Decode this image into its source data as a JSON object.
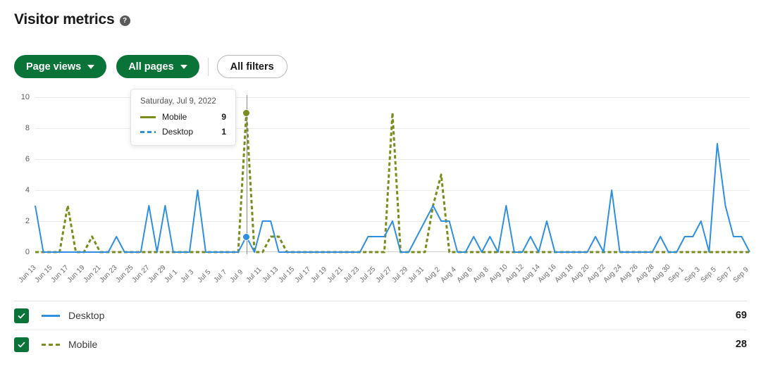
{
  "header": {
    "title": "Visitor metrics",
    "help_icon": "help-circle-icon",
    "help_glyph": "?"
  },
  "toolbar": {
    "metric_button": "Page views",
    "pages_button": "All pages",
    "filters_button": "All filters"
  },
  "tooltip": {
    "date": "Saturday, Jul 9, 2022",
    "rows": [
      {
        "name": "Mobile",
        "value": "9",
        "style": "solid",
        "color": "#7a8c1c"
      },
      {
        "name": "Desktop",
        "value": "1",
        "style": "dash",
        "color": "#2f8fe0"
      }
    ]
  },
  "legend": {
    "rows": [
      {
        "label": "Desktop",
        "value": "69",
        "style": "solid",
        "color": "#2f8fe0",
        "checked": true
      },
      {
        "label": "Mobile",
        "value": "28",
        "style": "dash",
        "color": "#7a8c1c",
        "checked": true
      }
    ]
  },
  "colors": {
    "brand_green": "#0a7338",
    "desktop": "#2f8fe0",
    "mobile": "#7a8c1c",
    "grid": "#ebebeb"
  },
  "chart_data": {
    "type": "line",
    "title": "Visitor metrics",
    "xlabel": "",
    "ylabel": "",
    "ylim": [
      0,
      10
    ],
    "yticks": [
      0,
      2,
      4,
      6,
      8,
      10
    ],
    "grid": true,
    "legend_position": "bottom",
    "tick_step_days": 2,
    "x": [
      "Jun 13",
      "Jun 14",
      "Jun 15",
      "Jun 16",
      "Jun 17",
      "Jun 18",
      "Jun 19",
      "Jun 20",
      "Jun 21",
      "Jun 22",
      "Jun 23",
      "Jun 24",
      "Jun 25",
      "Jun 26",
      "Jun 27",
      "Jun 28",
      "Jun 29",
      "Jun 30",
      "Jul 1",
      "Jul 2",
      "Jul 3",
      "Jul 4",
      "Jul 5",
      "Jul 6",
      "Jul 7",
      "Jul 8",
      "Jul 9",
      "Jul 10",
      "Jul 11",
      "Jul 12",
      "Jul 13",
      "Jul 14",
      "Jul 15",
      "Jul 16",
      "Jul 17",
      "Jul 18",
      "Jul 19",
      "Jul 20",
      "Jul 21",
      "Jul 22",
      "Jul 23",
      "Jul 24",
      "Jul 25",
      "Jul 26",
      "Jul 27",
      "Jul 28",
      "Jul 29",
      "Jul 30",
      "Jul 31",
      "Aug 1",
      "Aug 2",
      "Aug 3",
      "Aug 4",
      "Aug 5",
      "Aug 6",
      "Aug 7",
      "Aug 8",
      "Aug 9",
      "Aug 10",
      "Aug 11",
      "Aug 12",
      "Aug 13",
      "Aug 14",
      "Aug 15",
      "Aug 16",
      "Aug 17",
      "Aug 18",
      "Aug 19",
      "Aug 20",
      "Aug 21",
      "Aug 22",
      "Aug 23",
      "Aug 24",
      "Aug 25",
      "Aug 26",
      "Aug 27",
      "Aug 28",
      "Aug 29",
      "Aug 30",
      "Aug 31",
      "Sep 1",
      "Sep 2",
      "Sep 3",
      "Sep 4",
      "Sep 5",
      "Sep 6",
      "Sep 7",
      "Sep 8",
      "Sep 9"
    ],
    "xticks": [
      "Jun 13",
      "Jun 15",
      "Jun 17",
      "Jun 19",
      "Jun 21",
      "Jun 23",
      "Jun 25",
      "Jun 27",
      "Jun 29",
      "Jul 1",
      "Jul 3",
      "Jul 5",
      "Jul 7",
      "Jul 9",
      "Jul 11",
      "Jul 13",
      "Jul 15",
      "Jul 17",
      "Jul 19",
      "Jul 21",
      "Jul 23",
      "Jul 25",
      "Jul 27",
      "Jul 29",
      "Jul 31",
      "Aug 2",
      "Aug 4",
      "Aug 6",
      "Aug 8",
      "Aug 10",
      "Aug 12",
      "Aug 14",
      "Aug 16",
      "Aug 18",
      "Aug 20",
      "Aug 22",
      "Aug 24",
      "Aug 26",
      "Aug 28",
      "Aug 30",
      "Sep 1",
      "Sep 3",
      "Sep 5",
      "Sep 7",
      "Sep 9"
    ],
    "series": [
      {
        "name": "Desktop",
        "color": "#2f8fe0",
        "style": "solid",
        "total": 69,
        "values": [
          3,
          0,
          0,
          0,
          0,
          0,
          0,
          0,
          0,
          0,
          1,
          0,
          0,
          0,
          3,
          0,
          3,
          0,
          0,
          0,
          4,
          0,
          0,
          0,
          0,
          0,
          1,
          0,
          2,
          2,
          0,
          0,
          0,
          0,
          0,
          0,
          0,
          0,
          0,
          0,
          0,
          1,
          1,
          1,
          2,
          0,
          0,
          1,
          2,
          3,
          2,
          2,
          0,
          0,
          1,
          0,
          1,
          0,
          3,
          0,
          0,
          1,
          0,
          2,
          0,
          0,
          0,
          0,
          0,
          1,
          0,
          4,
          0,
          0,
          0,
          0,
          0,
          1,
          0,
          0,
          1,
          1,
          2,
          0,
          7,
          3,
          1,
          1,
          0
        ]
      },
      {
        "name": "Mobile",
        "color": "#7a8c1c",
        "style": "dashed",
        "total": 28,
        "values": [
          0,
          0,
          0,
          0,
          3,
          0,
          0,
          1,
          0,
          0,
          0,
          0,
          0,
          0,
          0,
          0,
          0,
          0,
          0,
          0,
          0,
          0,
          0,
          0,
          0,
          0,
          9,
          0,
          0,
          1,
          1,
          0,
          0,
          0,
          0,
          0,
          0,
          0,
          0,
          0,
          0,
          0,
          0,
          0,
          9,
          0,
          0,
          0,
          0,
          3,
          5,
          0,
          0,
          0,
          0,
          0,
          0,
          0,
          0,
          0,
          0,
          0,
          0,
          0,
          0,
          0,
          0,
          0,
          0,
          0,
          0,
          0,
          0,
          0,
          0,
          0,
          0,
          0,
          0,
          0,
          0,
          0,
          0,
          0,
          0,
          0,
          0,
          0,
          0
        ]
      }
    ],
    "highlight": {
      "x": "Jul 9",
      "points": [
        {
          "series": "Mobile",
          "value": 9,
          "color": "#7a8c1c"
        },
        {
          "series": "Desktop",
          "value": 1,
          "color": "#2f8fe0"
        }
      ]
    }
  }
}
